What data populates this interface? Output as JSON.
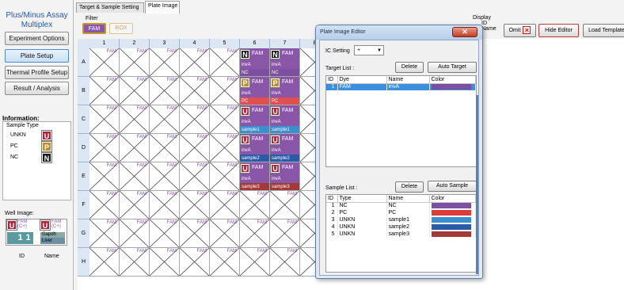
{
  "app": {
    "title": "Plus/Minus Assay Multiplex"
  },
  "nav": {
    "items": [
      {
        "label": "Experiment Options",
        "active": false
      },
      {
        "label": "Plate Setup",
        "active": true
      },
      {
        "label": "Thermal Profile Setup",
        "active": false
      },
      {
        "label": "Result / Analysis",
        "active": false
      }
    ]
  },
  "info": {
    "title": "Information:",
    "sample_type_caption": "Sample Type",
    "sample_types": [
      {
        "label": "UNKN",
        "icon": "U",
        "color": "#a8253c"
      },
      {
        "label": "PC",
        "icon": "P",
        "color": "#c08a2a"
      },
      {
        "label": "NC",
        "icon": "N",
        "color": "#1a1a1a"
      }
    ]
  },
  "well_legend": {
    "title": "Well Image:",
    "dye1": "FAM",
    "ic1": "(C+)",
    "dye2": "FAM",
    "ic2": "(C+)",
    "target": "Gapdh",
    "sample": "Liver",
    "id1": "1",
    "id2": "1",
    "id_label": "ID",
    "name_label": "Name"
  },
  "tabs": [
    {
      "label": "Target & Sample Setting",
      "active": false
    },
    {
      "label": "Plate Image",
      "active": true
    }
  ],
  "filter": {
    "label": "Filter",
    "buttons": [
      {
        "label": "FAM",
        "on": true
      },
      {
        "label": "ROX",
        "on": false
      }
    ]
  },
  "display": {
    "label_line1": "Display",
    "label_line2": "ID",
    "label_line3": "Name"
  },
  "toolbar": {
    "omit_label": "Omit",
    "hide_editor_label": "Hide Editor",
    "load_template_label": "Load Template"
  },
  "plate": {
    "columns": [
      "1",
      "2",
      "3",
      "4",
      "5",
      "6",
      "7",
      "8"
    ],
    "rows": [
      "A",
      "B",
      "C",
      "D",
      "E",
      "F",
      "G",
      "H"
    ],
    "empty_dye": "FAM",
    "filled_wells": [
      {
        "row": "A",
        "col": "6",
        "icon": "N",
        "icon_color": "#1a1a1a",
        "dye": "FAM",
        "target": "invA",
        "sample": "NC",
        "sample_color": "#7d4fa0"
      },
      {
        "row": "A",
        "col": "7",
        "icon": "N",
        "icon_color": "#1a1a1a",
        "dye": "FAM",
        "target": "invA",
        "sample": "NC",
        "sample_color": "#7d4fa0"
      },
      {
        "row": "B",
        "col": "6",
        "icon": "P",
        "icon_color": "#c08a2a",
        "dye": "FAM",
        "target": "invA",
        "sample": "PC",
        "sample_color": "#e05050"
      },
      {
        "row": "B",
        "col": "7",
        "icon": "P",
        "icon_color": "#c08a2a",
        "dye": "FAM",
        "target": "invA",
        "sample": "PC",
        "sample_color": "#e05050"
      },
      {
        "row": "C",
        "col": "6",
        "icon": "U",
        "icon_color": "#a8253c",
        "dye": "FAM",
        "target": "invA",
        "sample": "sample1",
        "sample_color": "#3a8fd0"
      },
      {
        "row": "C",
        "col": "7",
        "icon": "U",
        "icon_color": "#a8253c",
        "dye": "FAM",
        "target": "invA",
        "sample": "sample1",
        "sample_color": "#3a8fd0"
      },
      {
        "row": "D",
        "col": "6",
        "icon": "U",
        "icon_color": "#a8253c",
        "dye": "FAM",
        "target": "invA",
        "sample": "sample2",
        "sample_color": "#2a5ba8"
      },
      {
        "row": "D",
        "col": "7",
        "icon": "U",
        "icon_color": "#a8253c",
        "dye": "FAM",
        "target": "invA",
        "sample": "sample2",
        "sample_color": "#2a5ba8"
      },
      {
        "row": "E",
        "col": "6",
        "icon": "U",
        "icon_color": "#a8253c",
        "dye": "FAM",
        "target": "invA",
        "sample": "sample3",
        "sample_color": "#a23a3a"
      },
      {
        "row": "E",
        "col": "7",
        "icon": "U",
        "icon_color": "#a8253c",
        "dye": "FAM",
        "target": "invA",
        "sample": "sample3",
        "sample_color": "#a23a3a"
      }
    ]
  },
  "editor": {
    "title": "Plate Image Editor",
    "ic_setting_label": "IC Setting",
    "ic_setting_value": "+",
    "target_list_label": "Target List :",
    "sample_list_label": "Sample List :",
    "delete_label": "Delete",
    "auto_target_label": "Auto Target",
    "auto_sample_label": "Auto Sample",
    "target_headers": [
      "ID",
      "Dye",
      "Name",
      "Color"
    ],
    "targets": [
      {
        "id": "1",
        "dye": "FAM",
        "name": "invA",
        "color": "#7d4fa0"
      }
    ],
    "sample_headers": [
      "ID",
      "Type",
      "Name",
      "Color"
    ],
    "samples": [
      {
        "id": "1",
        "type": "NC",
        "name": "NC",
        "color": "#7d4fa0"
      },
      {
        "id": "2",
        "type": "PC",
        "name": "PC",
        "color": "#e03a3a"
      },
      {
        "id": "3",
        "type": "UNKN",
        "name": "sample1",
        "color": "#3a8fd0"
      },
      {
        "id": "4",
        "type": "UNKN",
        "name": "sample2",
        "color": "#2a5ba8"
      },
      {
        "id": "5",
        "type": "UNKN",
        "name": "sample3",
        "color": "#a23a3a"
      }
    ]
  }
}
